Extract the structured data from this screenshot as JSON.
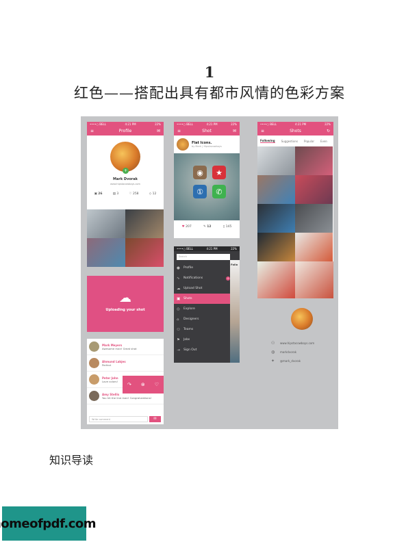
{
  "page": {
    "number": "1",
    "title": "红色——搭配出具有都市风情的色彩方案",
    "section": "知识导读",
    "logo": "homeofpdf.com"
  },
  "status_bar": {
    "carrier": "••••○ BELL",
    "time": "4:21 PM",
    "battery": "22%"
  },
  "profile_screen": {
    "title": "Profile",
    "name": "Mark Dvorak",
    "site": "www.hipstacowboys.com",
    "stats": [
      {
        "icon": "shots-icon",
        "value": "26"
      },
      {
        "icon": "projects-icon",
        "value": "3"
      },
      {
        "icon": "heart-icon",
        "value": "258"
      },
      {
        "icon": "tag-icon",
        "value": "12"
      }
    ]
  },
  "upload_card": {
    "label": "Uploading your shot"
  },
  "comments": {
    "items": [
      {
        "name": "Mark Meyers",
        "text": "Awesome man! Great shot"
      },
      {
        "name": "Ahmund Labjes",
        "text": "Perfect"
      },
      {
        "name": "Peter John",
        "text": "Love colors!"
      },
      {
        "name": "Amy Stellis",
        "text": "You hit the line man! Congratulations!"
      }
    ],
    "input_placeholder": "Write comment"
  },
  "shot_screen": {
    "title": "Shot",
    "shot_title": "Flat Icons.",
    "by": "by Mark | Hipstacowboys",
    "likes": "207",
    "comments": "12",
    "views": "145"
  },
  "menu_screen": {
    "search_placeholder": "Search",
    "peek_label": "Follo",
    "items": [
      {
        "label": "Profile",
        "icon": "profile-icon",
        "active": false
      },
      {
        "label": "Notifications",
        "icon": "pulse-icon",
        "active": false,
        "badge": "4"
      },
      {
        "label": "Upload Shot",
        "icon": "cloud-icon",
        "active": false
      },
      {
        "label": "Shots",
        "icon": "image-icon",
        "active": true
      },
      {
        "label": "Explore",
        "icon": "eye-icon",
        "active": false
      },
      {
        "label": "Designers",
        "icon": "designers-icon",
        "active": false
      },
      {
        "label": "Teams",
        "icon": "teams-icon",
        "active": false
      },
      {
        "label": "Jobs",
        "icon": "jobs-icon",
        "active": false
      },
      {
        "label": "Sign Out",
        "icon": "sign-out-icon",
        "active": false
      }
    ]
  },
  "shots_screen": {
    "title": "Shots",
    "tabs": [
      "Following",
      "Suggestions",
      "Popular",
      "Even"
    ]
  },
  "contact_card": {
    "site": "www.hipstacowboys.com",
    "dribbble": "markdvorak",
    "twitter": "@mark_dvorak"
  },
  "colors": {
    "accent": "#e2527f",
    "board": "#c4c5c7",
    "menu": "#3b3b3e",
    "logo_bg": "#1f958a"
  }
}
